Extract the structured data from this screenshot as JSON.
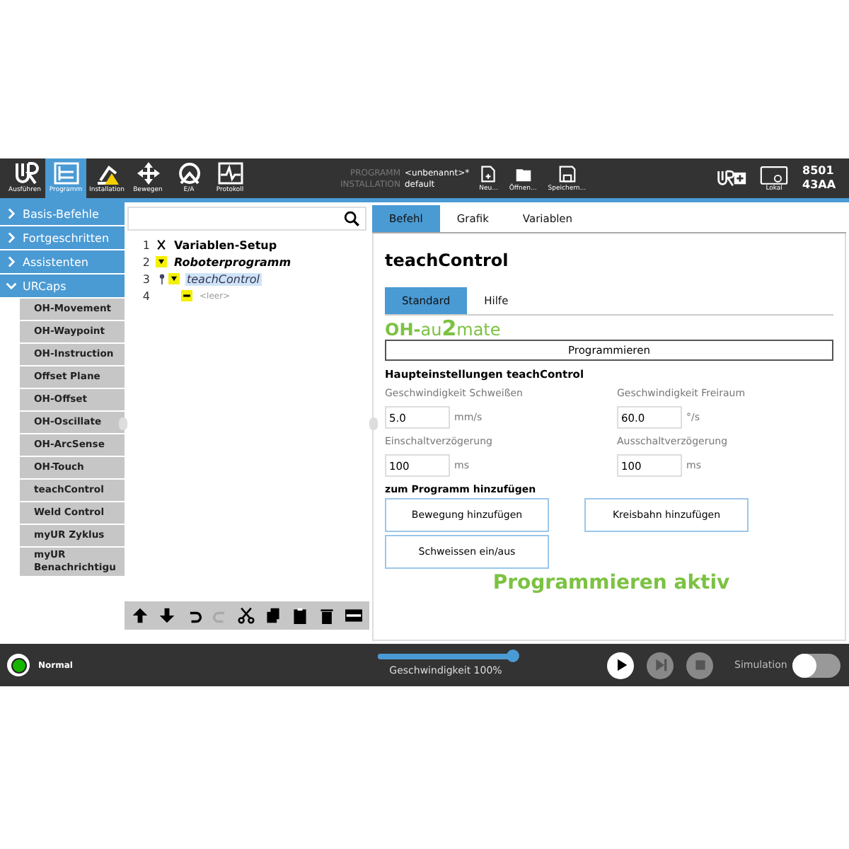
{
  "header": {
    "nav": [
      {
        "label": "Ausführen",
        "kind": "logo",
        "selected": false
      },
      {
        "label": "Programm",
        "kind": "program",
        "selected": true
      },
      {
        "label": "Installation",
        "kind": "install",
        "selected": false
      },
      {
        "label": "Bewegen",
        "kind": "move",
        "selected": false
      },
      {
        "label": "E/A",
        "kind": "io",
        "selected": false
      },
      {
        "label": "Protokoll",
        "kind": "log",
        "selected": false
      }
    ],
    "program_label": "PROGRAMM",
    "program_value": "<unbenannt>*",
    "installation_label": "INSTALLATION",
    "installation_value": "default",
    "file_actions": [
      {
        "label": "Neu...",
        "kind": "new"
      },
      {
        "label": "Öffnen...",
        "kind": "open"
      },
      {
        "label": "Speichern...",
        "kind": "save"
      }
    ],
    "local_label": "Lokal",
    "serial": [
      "8501",
      "43AA"
    ]
  },
  "categories": [
    {
      "label": "Basis-Befehle",
      "expanded": false
    },
    {
      "label": "Fortgeschritten",
      "expanded": false
    },
    {
      "label": "Assistenten",
      "expanded": false
    },
    {
      "label": "URCaps",
      "expanded": true
    }
  ],
  "urcaps_items": [
    "OH-Movement",
    "OH-Waypoint",
    "OH-Instruction",
    "Offset Plane",
    "OH-Offset",
    "OH-Oscillate",
    "OH-ArcSense",
    "OH-Touch",
    "teachControl",
    "Weld Control",
    "myUR Zyklus",
    "myUR Benachrichtigu"
  ],
  "tree": [
    {
      "number": "1",
      "label": "Variablen-Setup",
      "kind": "variables",
      "selected": false
    },
    {
      "number": "2",
      "label": "Roboterprogramm",
      "kind": "program",
      "selected": false,
      "children": [
        {
          "number": "3",
          "label": "teachControl",
          "kind": "node",
          "selected": true,
          "children": [
            {
              "number": "4",
              "label": "<leer>",
              "kind": "empty",
              "selected": false
            }
          ]
        }
      ]
    }
  ],
  "toolbar": [
    {
      "kind": "up",
      "disabled": false
    },
    {
      "kind": "down",
      "disabled": false
    },
    {
      "kind": "undo",
      "disabled": false
    },
    {
      "kind": "redo",
      "disabled": true
    },
    {
      "kind": "cut",
      "disabled": false
    },
    {
      "kind": "copy",
      "disabled": false
    },
    {
      "kind": "paste",
      "disabled": false
    },
    {
      "kind": "delete",
      "disabled": false
    },
    {
      "kind": "suppress",
      "disabled": false
    }
  ],
  "tabs": [
    {
      "label": "Befehl",
      "selected": true
    },
    {
      "label": "Grafik",
      "selected": false
    },
    {
      "label": "Variablen",
      "selected": false
    }
  ],
  "title": "teachControl",
  "subtabs": [
    {
      "label": "Standard",
      "selected": true
    },
    {
      "label": "Hilfe",
      "selected": false
    }
  ],
  "logo": [
    {
      "text": "OH-",
      "kind": "strong"
    },
    {
      "text": "au",
      "kind": "light"
    },
    {
      "text": "2",
      "kind": "big"
    },
    {
      "text": "mate",
      "kind": "light"
    }
  ],
  "program_button": "Programmieren",
  "settings_title": "Haupteinstellungen teachControl",
  "fields": [
    {
      "label": "Geschwindigkeit Schweißen",
      "value": "5.0",
      "unit": "mm/s"
    },
    {
      "label": "Geschwindigkeit Freiraum",
      "value": "60.0",
      "unit": "°/s"
    },
    {
      "label": "Einschaltverzögerung",
      "value": "100",
      "unit": "ms"
    },
    {
      "label": "Ausschaltverzögerung",
      "value": "100",
      "unit": "ms"
    }
  ],
  "add_title": "zum Programm hinzufügen",
  "add_buttons": [
    "Bewegung hinzufügen",
    "Kreisbahn hinzufügen",
    "Schweissen ein/aus"
  ],
  "status_text": "Programmieren aktiv",
  "footer": {
    "robot_status": "Normal",
    "speed": {
      "level": 1.0,
      "label": "Geschwindigkeit 100%"
    },
    "controls": [
      {
        "kind": "play",
        "disabled": false
      },
      {
        "kind": "step",
        "disabled": true
      },
      {
        "kind": "stop",
        "disabled": true
      }
    ],
    "simulation_label": "Simulation",
    "simulation_on": false
  }
}
